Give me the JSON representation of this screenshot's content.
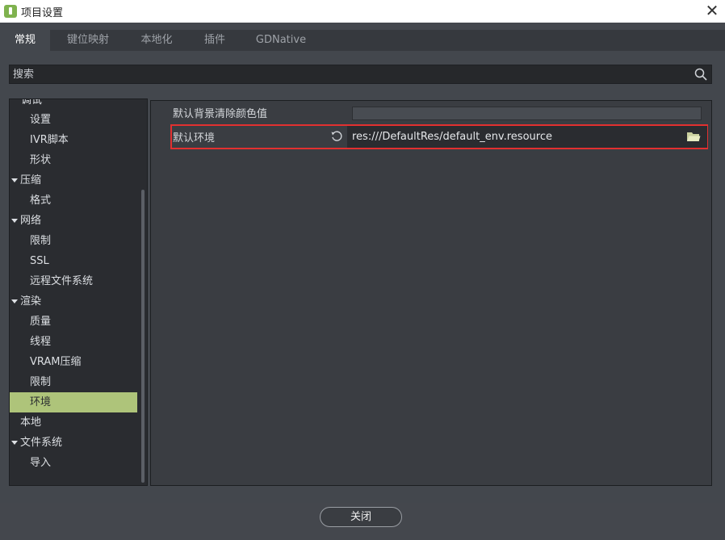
{
  "window": {
    "title": "项目设置",
    "close_glyph": "✕"
  },
  "tabs": [
    {
      "label": "常规",
      "active": true
    },
    {
      "label": "键位映射"
    },
    {
      "label": "本地化"
    },
    {
      "label": "插件"
    },
    {
      "label": "GDNative"
    }
  ],
  "search": {
    "placeholder": "搜索",
    "icon": "search-icon"
  },
  "tree": {
    "items": [
      {
        "label": "调试",
        "level": 0,
        "partial": true
      },
      {
        "label": "设置",
        "level": 1
      },
      {
        "label": "IVR脚本",
        "level": 1
      },
      {
        "label": "形状",
        "level": 1
      },
      {
        "label": "压缩",
        "level": 0,
        "expanded": true
      },
      {
        "label": "格式",
        "level": 1
      },
      {
        "label": "网络",
        "level": 0,
        "expanded": true
      },
      {
        "label": "限制",
        "level": 1
      },
      {
        "label": "SSL",
        "level": 1
      },
      {
        "label": "远程文件系统",
        "level": 1
      },
      {
        "label": "渲染",
        "level": 0,
        "expanded": true
      },
      {
        "label": "质量",
        "level": 1
      },
      {
        "label": "线程",
        "level": 1
      },
      {
        "label": "VRAM压缩",
        "level": 1
      },
      {
        "label": "限制",
        "level": 1
      },
      {
        "label": "环境",
        "level": 1,
        "selected": true
      },
      {
        "label": "本地",
        "level": 0
      },
      {
        "label": "文件系统",
        "level": 0,
        "expanded": true
      },
      {
        "label": "导入",
        "level": 1
      }
    ]
  },
  "properties": {
    "clear_color": {
      "label": "默认背景清除颜色值"
    },
    "environment": {
      "label": "默认环境",
      "value": "res:///DefaultRes/default_env.resource",
      "revert_icon": "revert-icon",
      "browse_icon": "folder-icon"
    }
  },
  "footer": {
    "close_label": "关闭"
  },
  "colors": {
    "selection": "#aec47a",
    "highlight_border": "#e23030",
    "accent": "#7fb24e"
  }
}
